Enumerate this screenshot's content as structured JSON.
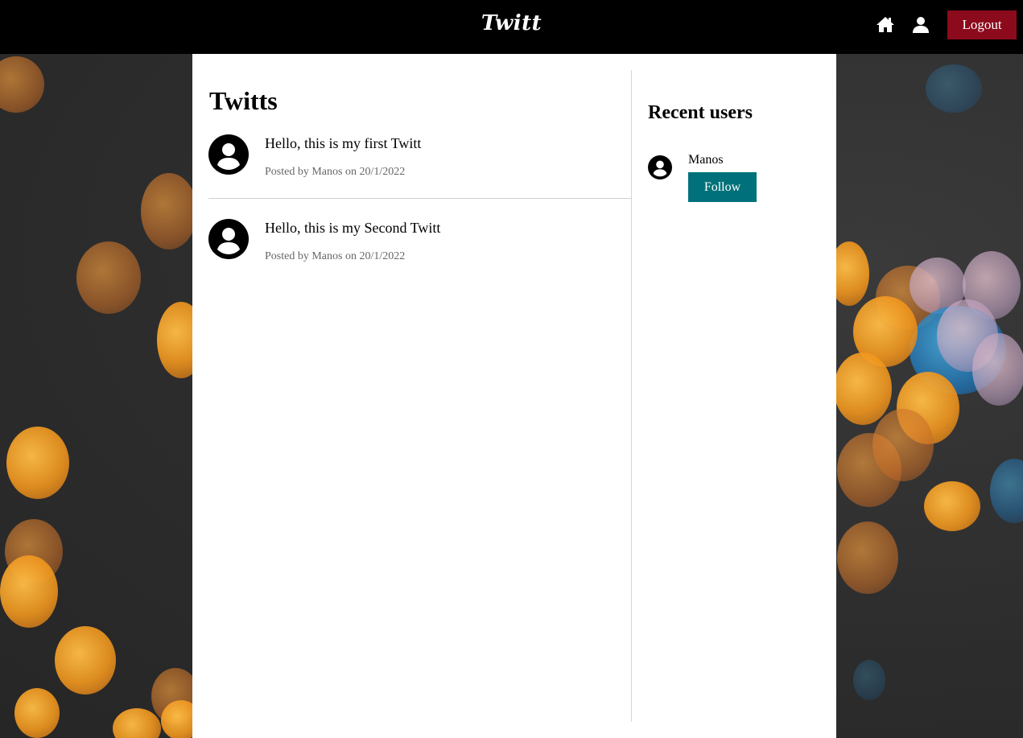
{
  "header": {
    "logo": "Twitt",
    "icons": [
      "home-icon",
      "user-icon"
    ],
    "logout_label": "Logout"
  },
  "feed": {
    "title": "Twitts",
    "posts": [
      {
        "text": "Hello, this is my first Twitt",
        "meta": "Posted by Manos on 20/1/2022"
      },
      {
        "text": "Hello, this is my Second Twitt",
        "meta": "Posted by Manos on 20/1/2022"
      }
    ]
  },
  "sidebar": {
    "title": "Recent users",
    "users": [
      {
        "name": "Manos",
        "follow_label": "Follow"
      }
    ]
  },
  "colors": {
    "header_bg": "#000000",
    "logout_bg": "#8b0a1c",
    "follow_bg": "#00717a",
    "background_bokeh": [
      "#f0a020",
      "#3aa0d8"
    ]
  }
}
